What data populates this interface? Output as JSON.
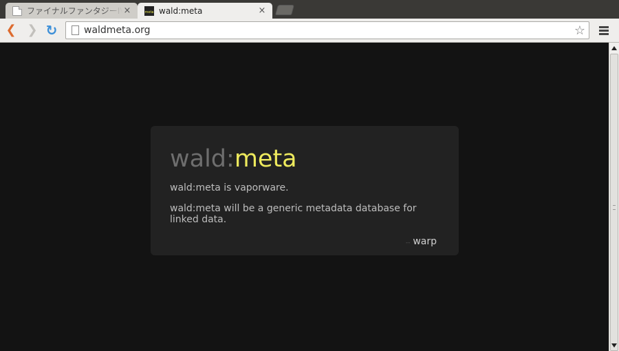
{
  "tabs": [
    {
      "title": "ファイナルファンタジーIV - su",
      "close": "×"
    },
    {
      "title": "wald:meta",
      "close": "×",
      "favicon_text": "meta"
    }
  ],
  "toolbar": {
    "back_icon": "❮",
    "forward_icon": "❯",
    "reload_icon": "↻",
    "url": "waldmeta.org",
    "star_icon": "☆"
  },
  "page": {
    "heading_part1": "wald:",
    "heading_part2": "meta",
    "para1": "wald:meta is vaporware.",
    "para2": "wald:meta will be a generic metadata database for linked data.",
    "signature_dash": "--",
    "signature": "warp"
  },
  "colors": {
    "heading_muted": "#6e6e6e",
    "heading_accent": "#eeea5d",
    "page_bg": "#131313",
    "card_bg": "#222222"
  }
}
